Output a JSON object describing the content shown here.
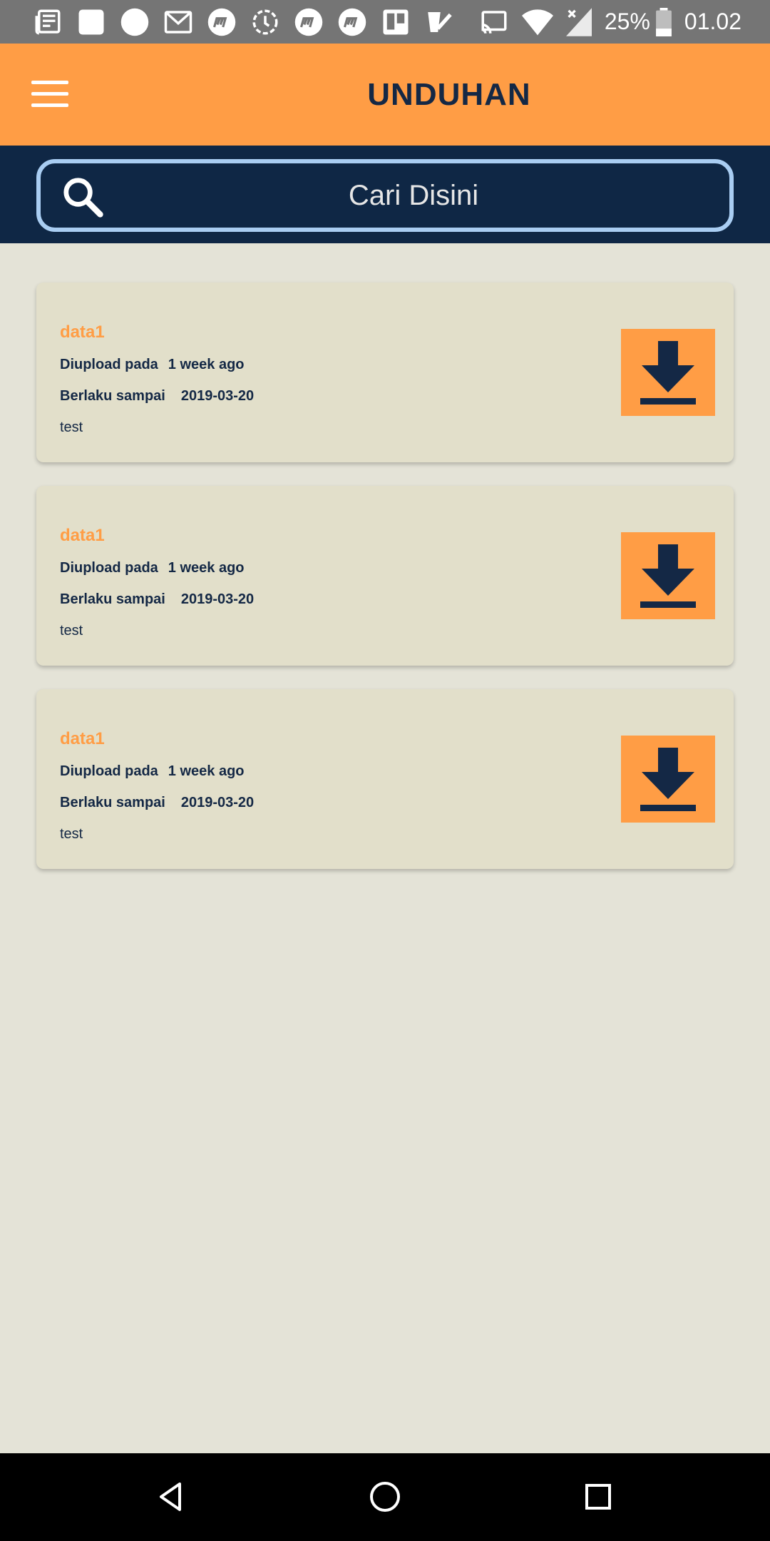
{
  "status_bar": {
    "battery": "25%",
    "time": "01.02"
  },
  "app_bar": {
    "title": "UNDUHAN"
  },
  "search": {
    "placeholder": "Cari Disini"
  },
  "downloads": [
    {
      "title": "data1",
      "uploaded_label": "Diupload pada",
      "uploaded_value": "1 week ago",
      "valid_label": "Berlaku sampai",
      "valid_value": "2019-03-20",
      "description": "test"
    },
    {
      "title": "data1",
      "uploaded_label": "Diupload pada",
      "uploaded_value": "1 week ago",
      "valid_label": "Berlaku sampai",
      "valid_value": "2019-03-20",
      "description": "test"
    },
    {
      "title": "data1",
      "uploaded_label": "Diupload pada",
      "uploaded_value": "1 week ago",
      "valid_label": "Berlaku sampai",
      "valid_value": "2019-03-20",
      "description": "test"
    }
  ],
  "colors": {
    "accent": "#ff9d45",
    "navy": "#0f2745",
    "background": "#e4e3d7",
    "card": "#e2dfca"
  }
}
